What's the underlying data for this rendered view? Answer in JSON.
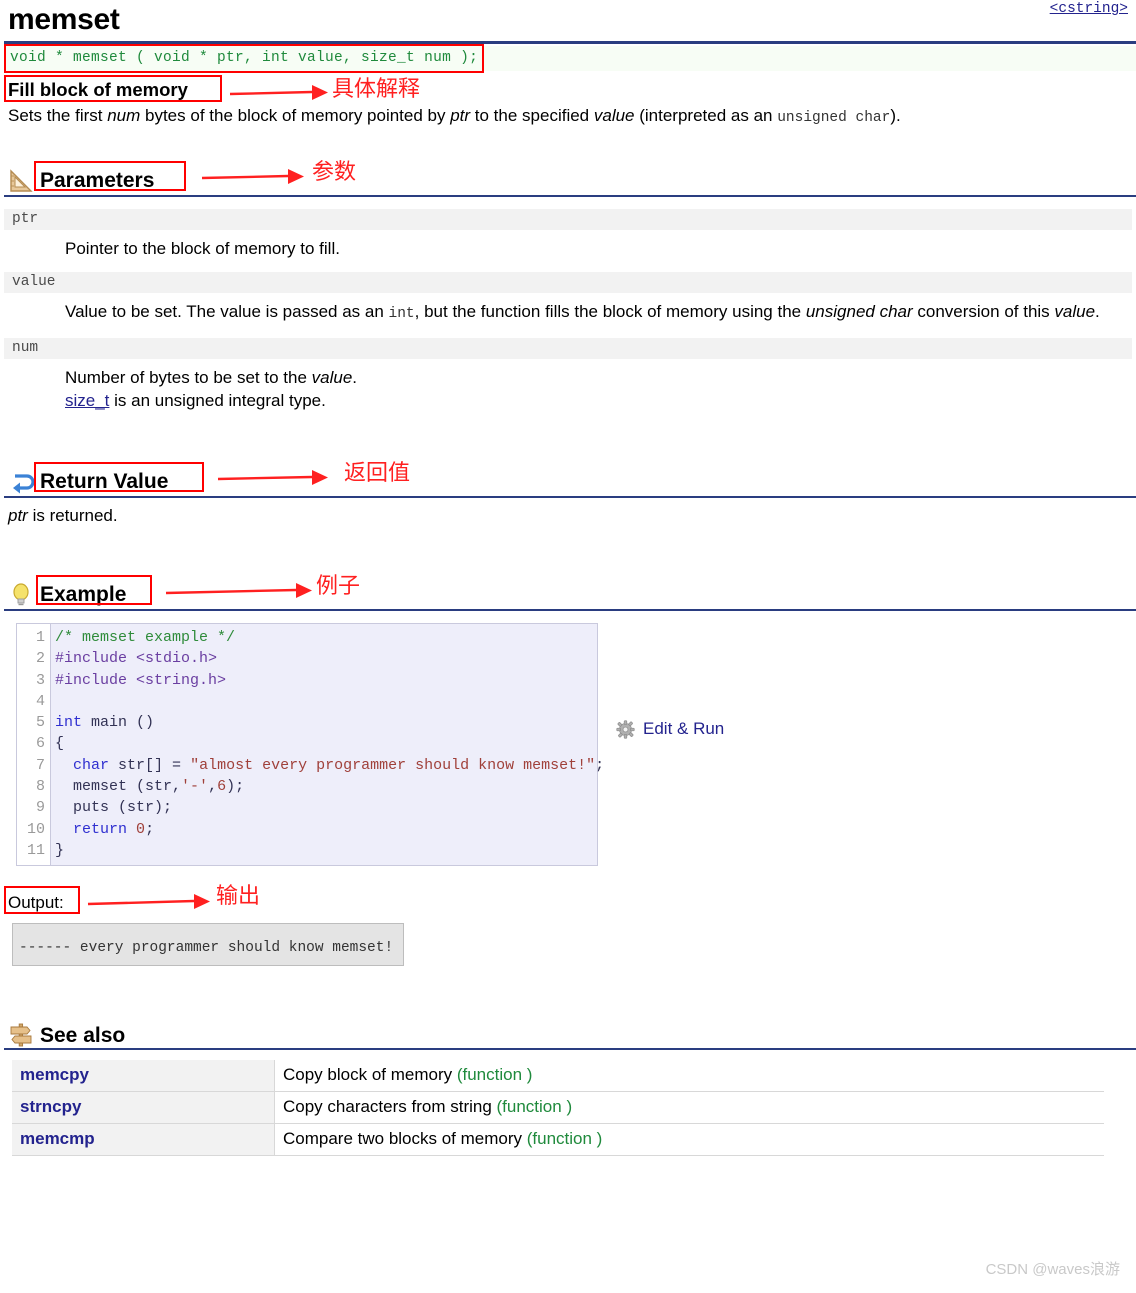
{
  "header": {
    "title": "memset",
    "header_file": "<cstring>"
  },
  "prototype": "void * memset ( void * ptr, int value, size_t num );",
  "brief": {
    "title": "Fill block of memory",
    "description_parts": [
      {
        "text": "Sets the first ",
        "style": "plain"
      },
      {
        "text": "num",
        "style": "italic"
      },
      {
        "text": " bytes of the block of memory pointed by ",
        "style": "plain"
      },
      {
        "text": "ptr",
        "style": "italic"
      },
      {
        "text": " to the specified ",
        "style": "plain"
      },
      {
        "text": "value",
        "style": "italic"
      },
      {
        "text": " (interpreted as an ",
        "style": "plain"
      },
      {
        "text": "unsigned char",
        "style": "mono"
      },
      {
        "text": ").",
        "style": "plain"
      }
    ],
    "description_text": "Sets the first num bytes of the block of memory pointed by ptr to the specified value (interpreted as an unsigned char)."
  },
  "sections": {
    "parameters": {
      "title": "Parameters",
      "icon": "ruler-triangle-icon",
      "items": [
        {
          "name": "ptr",
          "description": "Pointer to the block of memory to fill."
        },
        {
          "name": "value",
          "description": "Value to be set. The value is passed as an int, but the function fills the block of memory using the unsigned char conversion of this value."
        },
        {
          "name": "num",
          "description": "Number of bytes to be set to the value.",
          "description2_prefix": "size_t",
          "description2_suffix": " is an unsigned integral type."
        }
      ]
    },
    "return_value": {
      "title": "Return Value",
      "icon": "return-arrow-icon",
      "body_italic": "ptr",
      "body_rest": " is returned."
    },
    "example": {
      "title": "Example",
      "icon": "lightbulb-icon",
      "line_numbers": [
        "1",
        "2",
        "3",
        "4",
        "5",
        "6",
        "7",
        "8",
        "9",
        "10",
        "11"
      ],
      "code_lines": [
        "/* memset example */",
        "#include <stdio.h>",
        "#include <string.h>",
        "",
        "int main ()",
        "{",
        "  char str[] = \"almost every programmer should know memset!\";",
        "  memset (str,'-',6);",
        "  puts (str);",
        "  return 0;",
        "}"
      ],
      "edit_run_label": "Edit & Run",
      "edit_run_icon": "gear-icon"
    },
    "output": {
      "label": "Output:",
      "text": "------ every programmer should know memset!"
    },
    "see_also": {
      "title": "See also",
      "icon": "signpost-icon",
      "rows": [
        {
          "name": "memcpy",
          "description": "Copy block of memory ",
          "kind": "(function )"
        },
        {
          "name": "strncpy",
          "description": "Copy characters from string ",
          "kind": "(function )"
        },
        {
          "name": "memcmp",
          "description": "Compare two blocks of memory ",
          "kind": "(function )"
        }
      ]
    }
  },
  "annotations": [
    {
      "id": "anno-prototype",
      "text": ""
    },
    {
      "id": "anno-brief",
      "text": "具体解释"
    },
    {
      "id": "anno-parameters",
      "text": "参数"
    },
    {
      "id": "anno-return",
      "text": "返回值"
    },
    {
      "id": "anno-example",
      "text": "例子"
    },
    {
      "id": "anno-output",
      "text": "输出"
    }
  ],
  "watermark": "CSDN @waves浪游",
  "colors": {
    "rule_blue": "#2a3d80",
    "annotation_red": "#ff0000",
    "link_navy": "#23238e",
    "prototype_green": "#1f8a3c",
    "code_bg": "#eeeefa"
  }
}
